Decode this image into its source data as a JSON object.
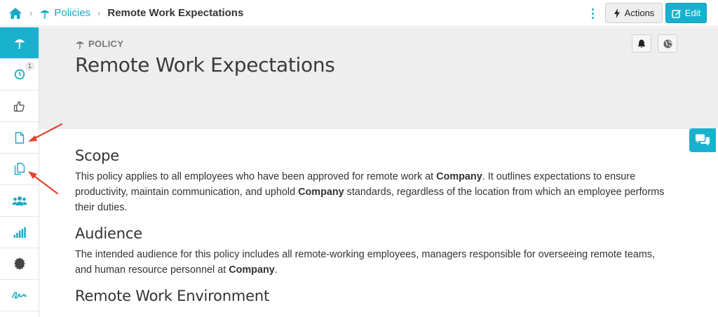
{
  "breadcrumb": {
    "parent": "Policies",
    "current": "Remote Work Expectations"
  },
  "toolbar": {
    "actions_label": "Actions",
    "edit_label": "Edit"
  },
  "sidebar": {
    "items": [
      {
        "icon": "umbrella-icon",
        "active": true
      },
      {
        "icon": "clock-icon",
        "badge": "1"
      },
      {
        "icon": "thumbs-up-icon"
      },
      {
        "icon": "document-icon"
      },
      {
        "icon": "copy-documents-icon"
      },
      {
        "icon": "users-icon"
      },
      {
        "icon": "signal-bars-icon"
      },
      {
        "icon": "certificate-icon"
      },
      {
        "icon": "signature-icon"
      }
    ]
  },
  "header": {
    "kicker": "POLICY",
    "title": "Remote Work Expectations"
  },
  "content": {
    "scope_heading": "Scope",
    "scope_text_1": "This policy applies to all employees who have been approved for remote work at ",
    "scope_company_1": "Company",
    "scope_text_2": ". It outlines expectations to ensure productivity, maintain communication, and uphold ",
    "scope_company_2": "Company",
    "scope_text_3": " standards, regardless of the location from which an employee performs their duties.",
    "audience_heading": "Audience",
    "audience_text_1": "The intended audience for this policy includes all remote-working employees, managers responsible for overseeing remote teams, and human resource personnel at ",
    "audience_company": "Company",
    "audience_text_2": ".",
    "environment_heading": "Remote Work Environment"
  },
  "colors": {
    "accent": "#1ab1cf",
    "annotation_arrow": "#e2442f"
  }
}
